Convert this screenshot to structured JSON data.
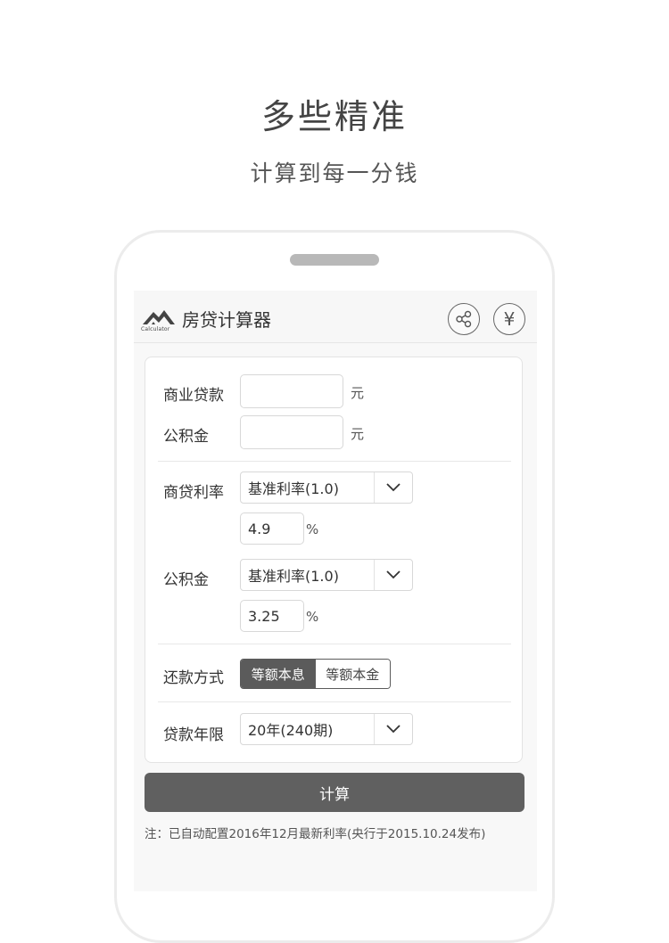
{
  "promo": {
    "headline": "多些精准",
    "subline": "计算到每一分钱"
  },
  "app": {
    "logo_caption": "Calculator",
    "title": "房贷计算器",
    "share_icon": "share-icon",
    "yen_symbol": "¥"
  },
  "form": {
    "commercial_loan": {
      "label": "商业贷款",
      "value": "",
      "unit": "元"
    },
    "provident_fund": {
      "label": "公积金",
      "value": "",
      "unit": "元"
    },
    "commercial_rate": {
      "label": "商贷利率",
      "selected": "基准利率(1.0)",
      "value": "4.9",
      "unit": "%"
    },
    "provident_rate": {
      "label": "公积金",
      "selected": "基准利率(1.0)",
      "value": "3.25",
      "unit": "%"
    },
    "repayment": {
      "label": "还款方式",
      "options": [
        "等额本息",
        "等额本金"
      ],
      "selected_index": 0
    },
    "term": {
      "label": "贷款年限",
      "selected": "20年(240期)"
    }
  },
  "calculate_label": "计算",
  "note": "注：已自动配置2016年12月最新利率(央行于2015.10.24发布)",
  "colors": {
    "accent": "#5b5b5b",
    "button": "#606060"
  }
}
